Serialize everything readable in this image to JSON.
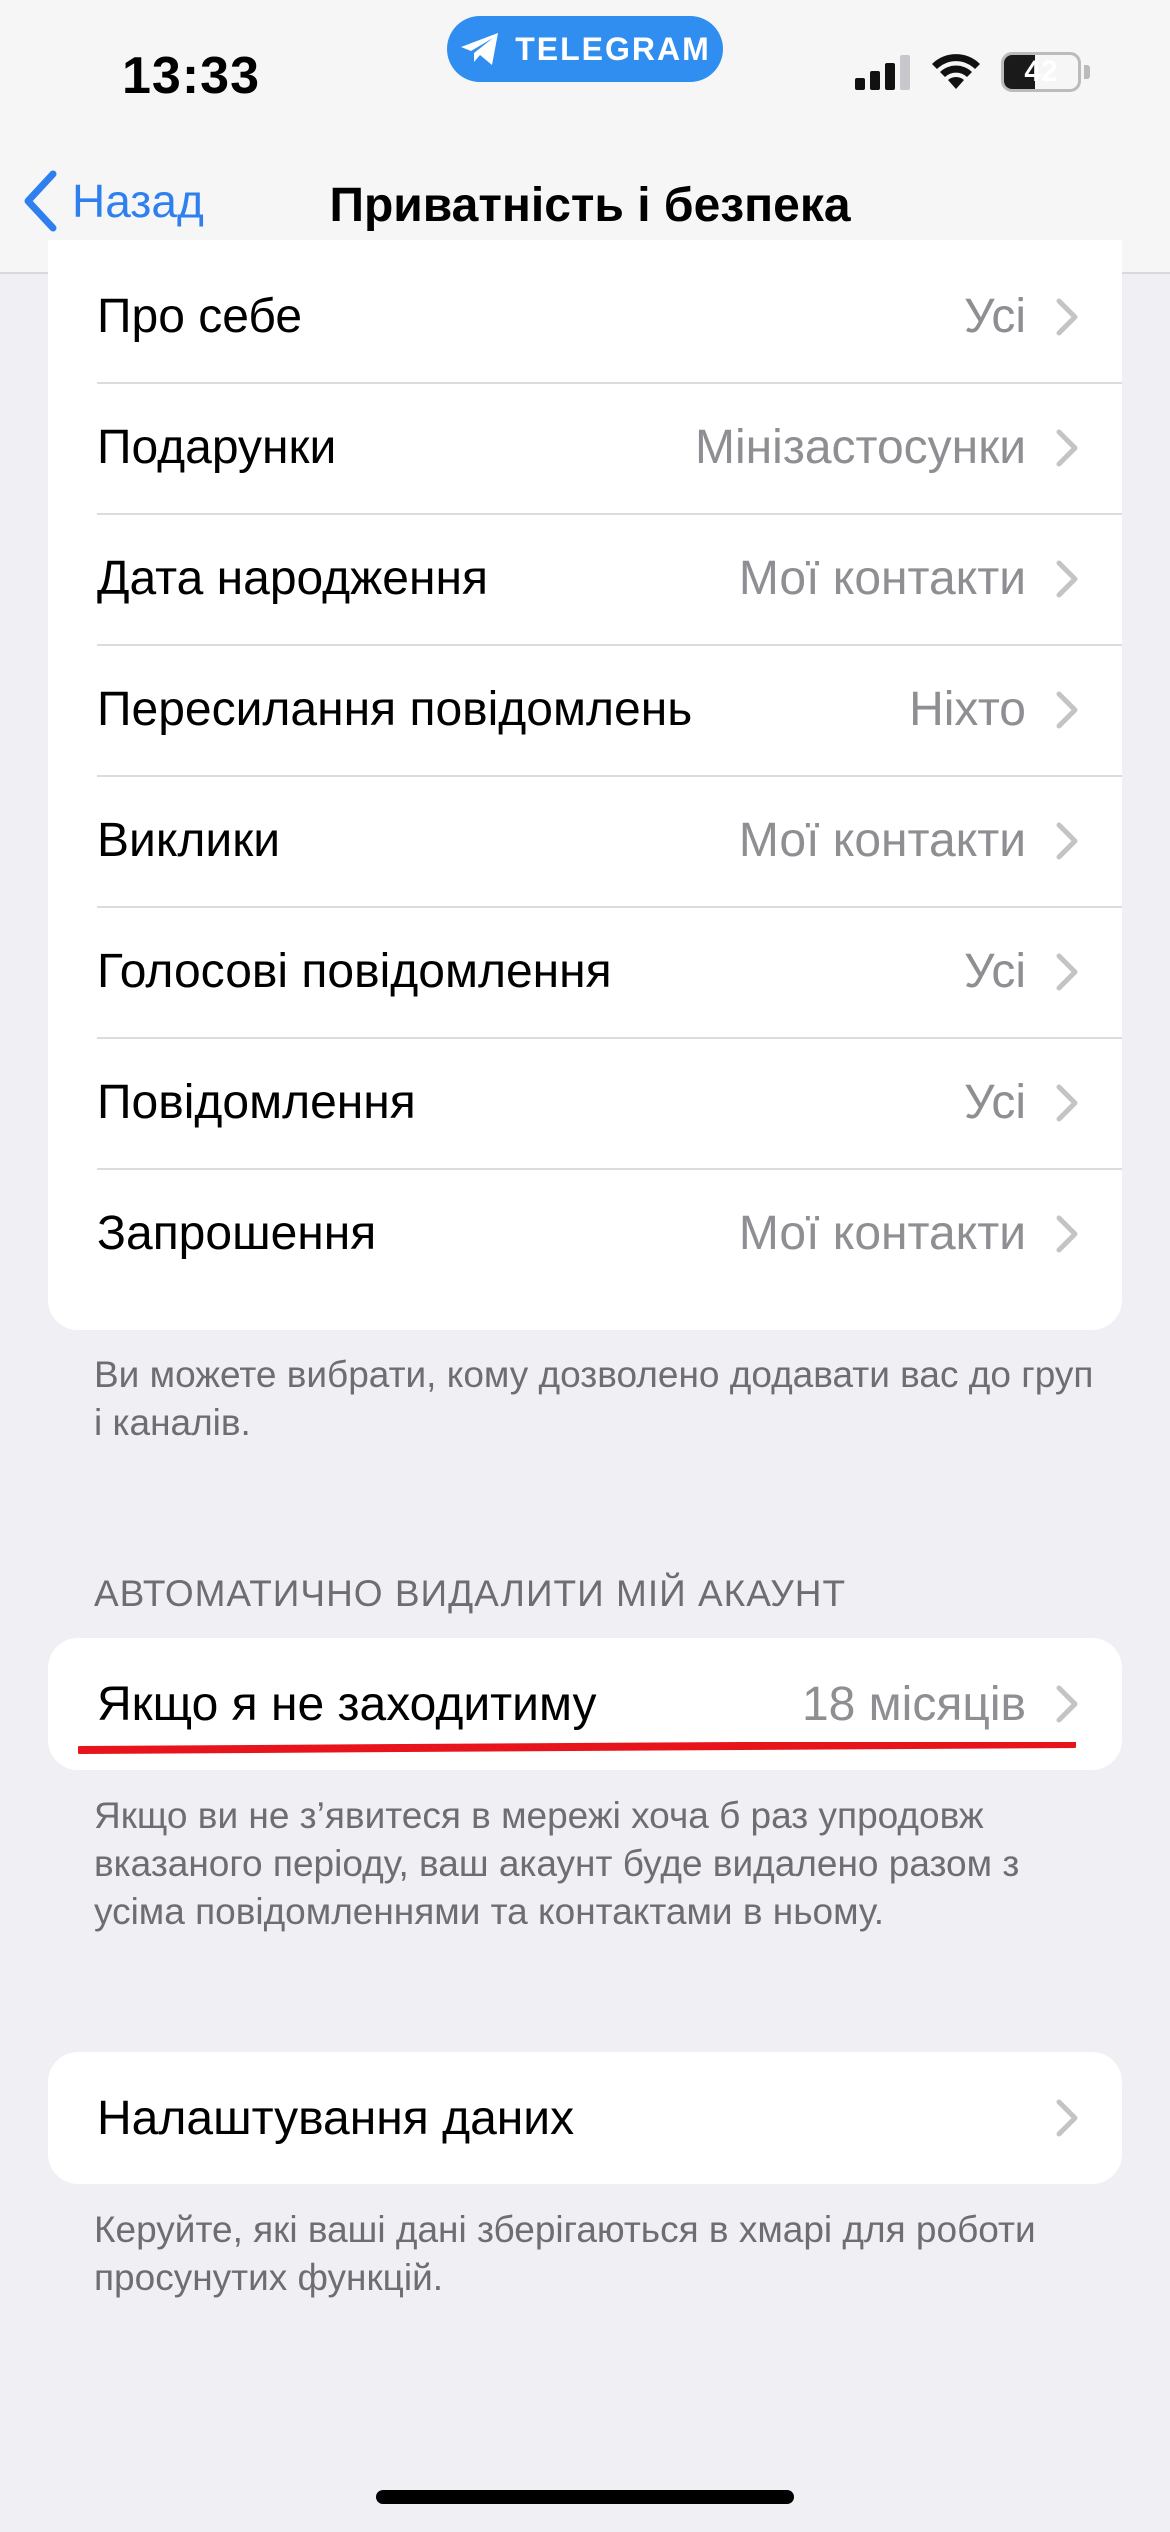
{
  "status_bar": {
    "time": "13:33",
    "app_pill": "TELEGRAM",
    "battery_level": 42,
    "battery_text": "42"
  },
  "nav": {
    "back_label": "Назад",
    "title": "Приватність і безпека"
  },
  "privacy_items": [
    {
      "label": "Про себе",
      "value": "Усі"
    },
    {
      "label": "Подарунки",
      "value": "Мінізастосунки"
    },
    {
      "label": "Дата народження",
      "value": "Мої контакти"
    },
    {
      "label": "Пересилання повідомлень",
      "value": "Ніхто"
    },
    {
      "label": "Виклики",
      "value": "Мої контакти"
    },
    {
      "label": "Голосові повідомлення",
      "value": "Усі"
    },
    {
      "label": "Повідомлення",
      "value": "Усі"
    },
    {
      "label": "Запрошення",
      "value": "Мої контакти"
    }
  ],
  "invites_footer": "Ви можете вибрати, кому дозволено додавати вас до груп і каналів.",
  "auto_delete": {
    "header": "АВТОМАТИЧНО ВИДАЛИТИ МІЙ АКАУНТ",
    "label": "Якщо я не заходитиму",
    "value": "18 місяців",
    "footer": "Якщо ви не з’явитеся в мережі хоча б раз упродовж вказаного періоду, ваш акаунт буде видалено разом з усіма повідомленнями та контактами в ньому."
  },
  "data_settings": {
    "label": "Налаштування даних",
    "footer": "Керуйте, які ваші дані зберігаються в хмарі для роботи просунутих функцій."
  },
  "colors": {
    "accent": "#2f80ee",
    "telegram_pill": "#2f8ef0",
    "annotation_red": "#e8141c",
    "background": "#efeff4"
  }
}
